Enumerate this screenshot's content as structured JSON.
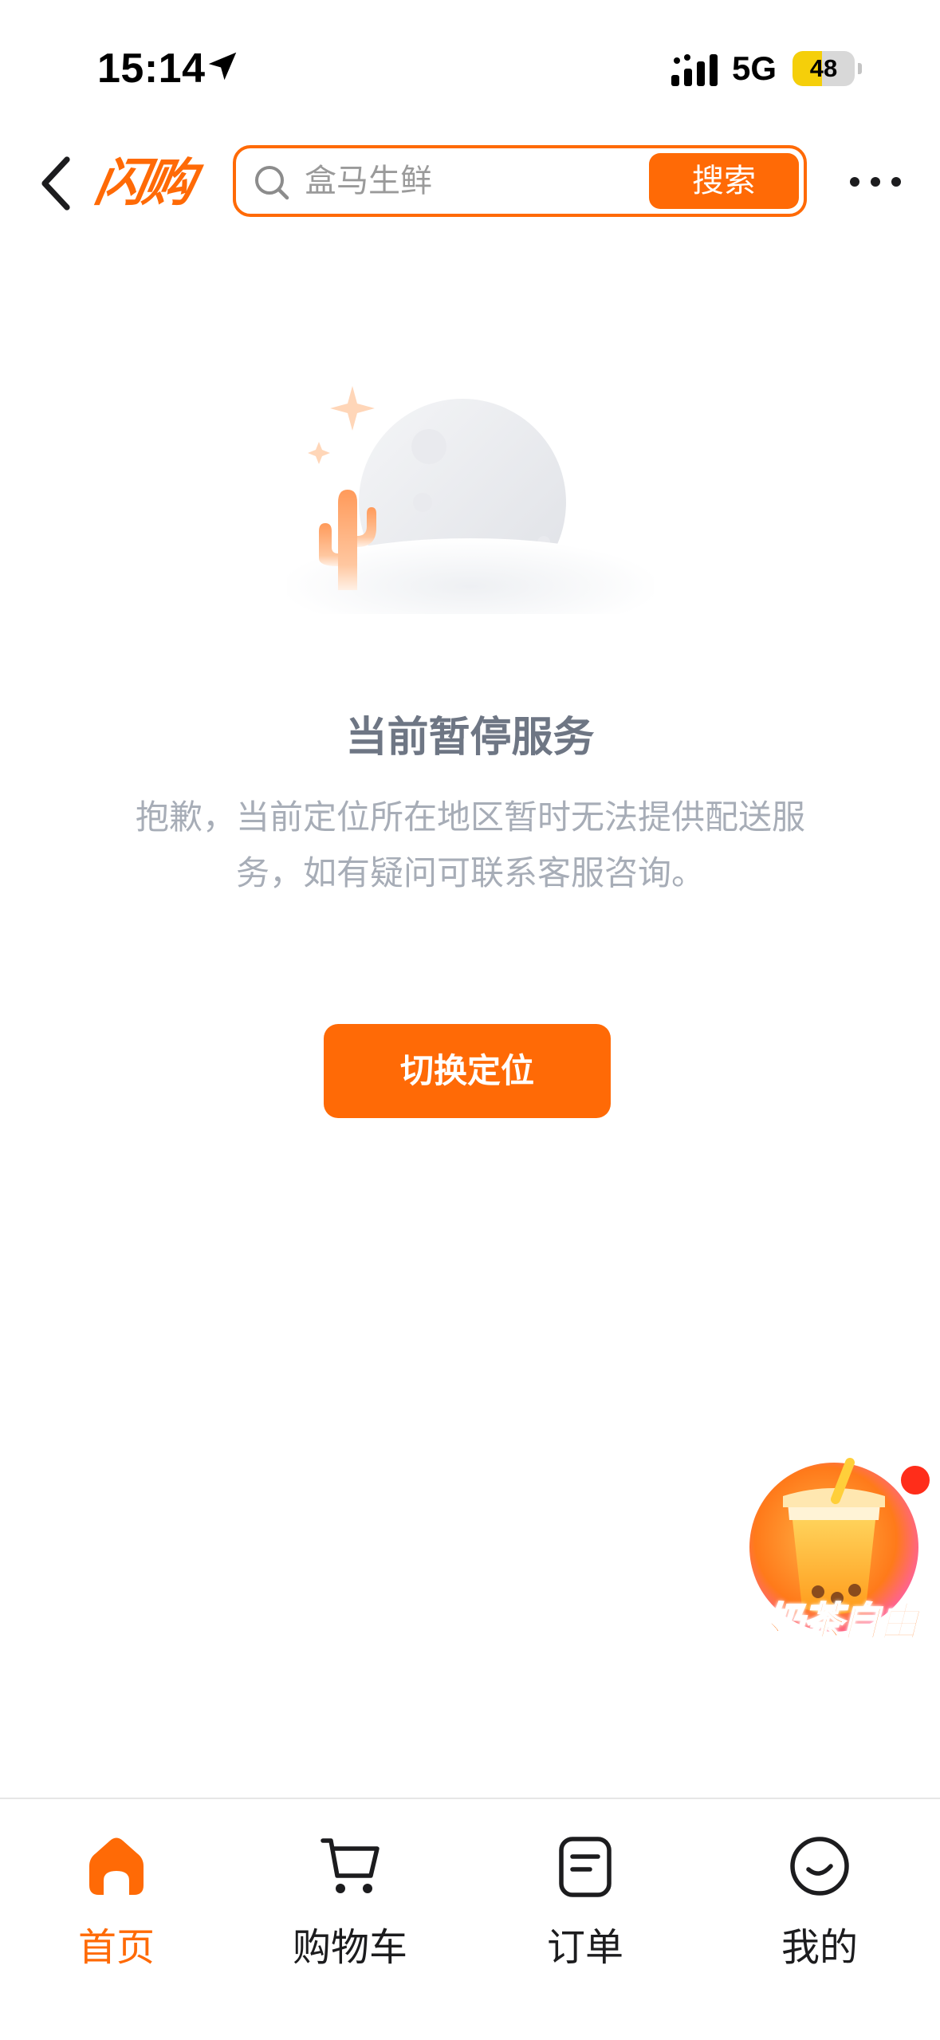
{
  "status_bar": {
    "time": "15:14",
    "network": "5G",
    "battery_level": "48",
    "battery_fraction": 0.48
  },
  "header": {
    "brand": "闪购",
    "search": {
      "placeholder": "盒马生鲜",
      "value": "",
      "button_label": "搜索"
    }
  },
  "empty_state": {
    "title": "当前暂停服务",
    "description": "抱歉，当前定位所在地区暂时无法提供配送服务，如有疑问可联系客服咨询。",
    "button_label": "切换定位"
  },
  "promo": {
    "label": "奶茶自由"
  },
  "tabs": [
    {
      "label": "首页",
      "icon": "home-icon",
      "active": true
    },
    {
      "label": "购物车",
      "icon": "cart-icon",
      "active": false
    },
    {
      "label": "订单",
      "icon": "order-icon",
      "active": false
    },
    {
      "label": "我的",
      "icon": "profile-icon",
      "active": false
    }
  ],
  "colors": {
    "accent": "#ff6a06",
    "title_gray": "#6e7684",
    "desc_gray": "#a7adb7",
    "battery_yellow": "#f5cf0a"
  }
}
